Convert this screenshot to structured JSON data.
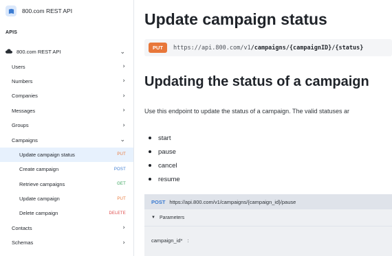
{
  "sidebar": {
    "brand_title": "800.com REST API",
    "section_label": "APIS",
    "items": [
      {
        "label": "800.com REST API",
        "level": 0,
        "chevron": "⌄",
        "icon": "cloud-icon"
      },
      {
        "label": "Users",
        "level": 1,
        "chevron": "›"
      },
      {
        "label": "Numbers",
        "level": 1,
        "chevron": "›"
      },
      {
        "label": "Companies",
        "level": 1,
        "chevron": "›"
      },
      {
        "label": "Messages",
        "level": 1,
        "chevron": "›"
      },
      {
        "label": "Groups",
        "level": 1,
        "chevron": "›"
      },
      {
        "label": "Campaigns",
        "level": 1,
        "chevron": "⌄"
      },
      {
        "label": "Update campaign status",
        "level": 2,
        "method": "PUT",
        "active": true
      },
      {
        "label": "Create campaign",
        "level": 2,
        "method": "POST"
      },
      {
        "label": "Retrieve campaigns",
        "level": 2,
        "method": "GET"
      },
      {
        "label": "Update campaign",
        "level": 2,
        "method": "PUT"
      },
      {
        "label": "Delete campaign",
        "level": 2,
        "method": "DELETE"
      },
      {
        "label": "Contacts",
        "level": 1,
        "chevron": "›"
      },
      {
        "label": "Schemas",
        "level": 1,
        "chevron": "›"
      }
    ]
  },
  "main": {
    "page_title": "Update campaign status",
    "endpoint": {
      "method": "PUT",
      "url_base": "https://api.800.com/v1",
      "url_path": "/campaigns/{campaignID}/{status}"
    },
    "section_title": "Updating the status of a campaign",
    "intro": "Use this endpoint to update the status of a campaign. The valid statuses ar",
    "statuses": [
      "start",
      "pause",
      "cancel",
      "resume"
    ],
    "request_panel": {
      "method": "POST",
      "url": "https://api.800.com/v1/campaigns/{campaign_id}/pause",
      "parameters_label": "Parameters",
      "param_name": "campaign_id*",
      "param_colon": ":"
    }
  },
  "colors": {
    "put": "#e8773a",
    "post": "#3b7bd1",
    "get": "#3aa55d",
    "delete": "#de4848",
    "active_bg": "#e7f1fd"
  }
}
